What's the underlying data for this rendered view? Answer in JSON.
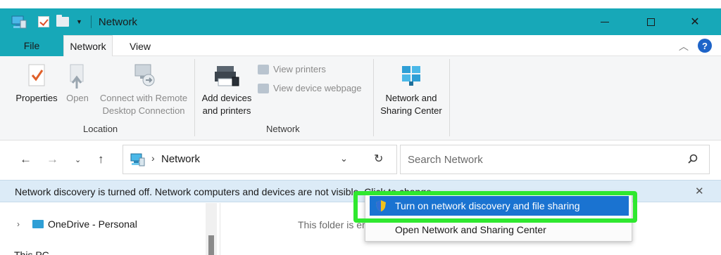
{
  "window": {
    "title": "Network",
    "accent": "#17a8b8",
    "controls": {
      "minimize": "",
      "maximize": "",
      "close": "✕"
    }
  },
  "tabs": {
    "file": "File",
    "items": [
      "Network",
      "View"
    ],
    "active": "Network"
  },
  "ribbon": {
    "location": {
      "properties": "Properties",
      "open": "Open",
      "connect_remote_line1": "Connect with Remote",
      "connect_remote_line2": "Desktop Connection",
      "group_label": "Location"
    },
    "network": {
      "add_devices_line1": "Add devices",
      "add_devices_line2": "and printers",
      "view_printers": "View printers",
      "view_device_webpage": "View device webpage",
      "group_label": "Network"
    },
    "sharing": {
      "line1": "Network and",
      "line2": "Sharing Center"
    }
  },
  "address": {
    "breadcrumb": "Network",
    "search_placeholder": "Search Network"
  },
  "infobar": {
    "text": "Network discovery is turned off. Network computers and devices are not visible. Click to change...",
    "close": "✕"
  },
  "navpane": {
    "items": [
      "OneDrive - Personal",
      "This PC"
    ]
  },
  "content": {
    "empty_text": "This folder is empty."
  },
  "context_menu": {
    "items": [
      "Turn on network discovery and file sharing",
      "Open Network and Sharing Center"
    ],
    "highlight_color": "#2fe82f",
    "selected_color": "#1a73d1"
  }
}
